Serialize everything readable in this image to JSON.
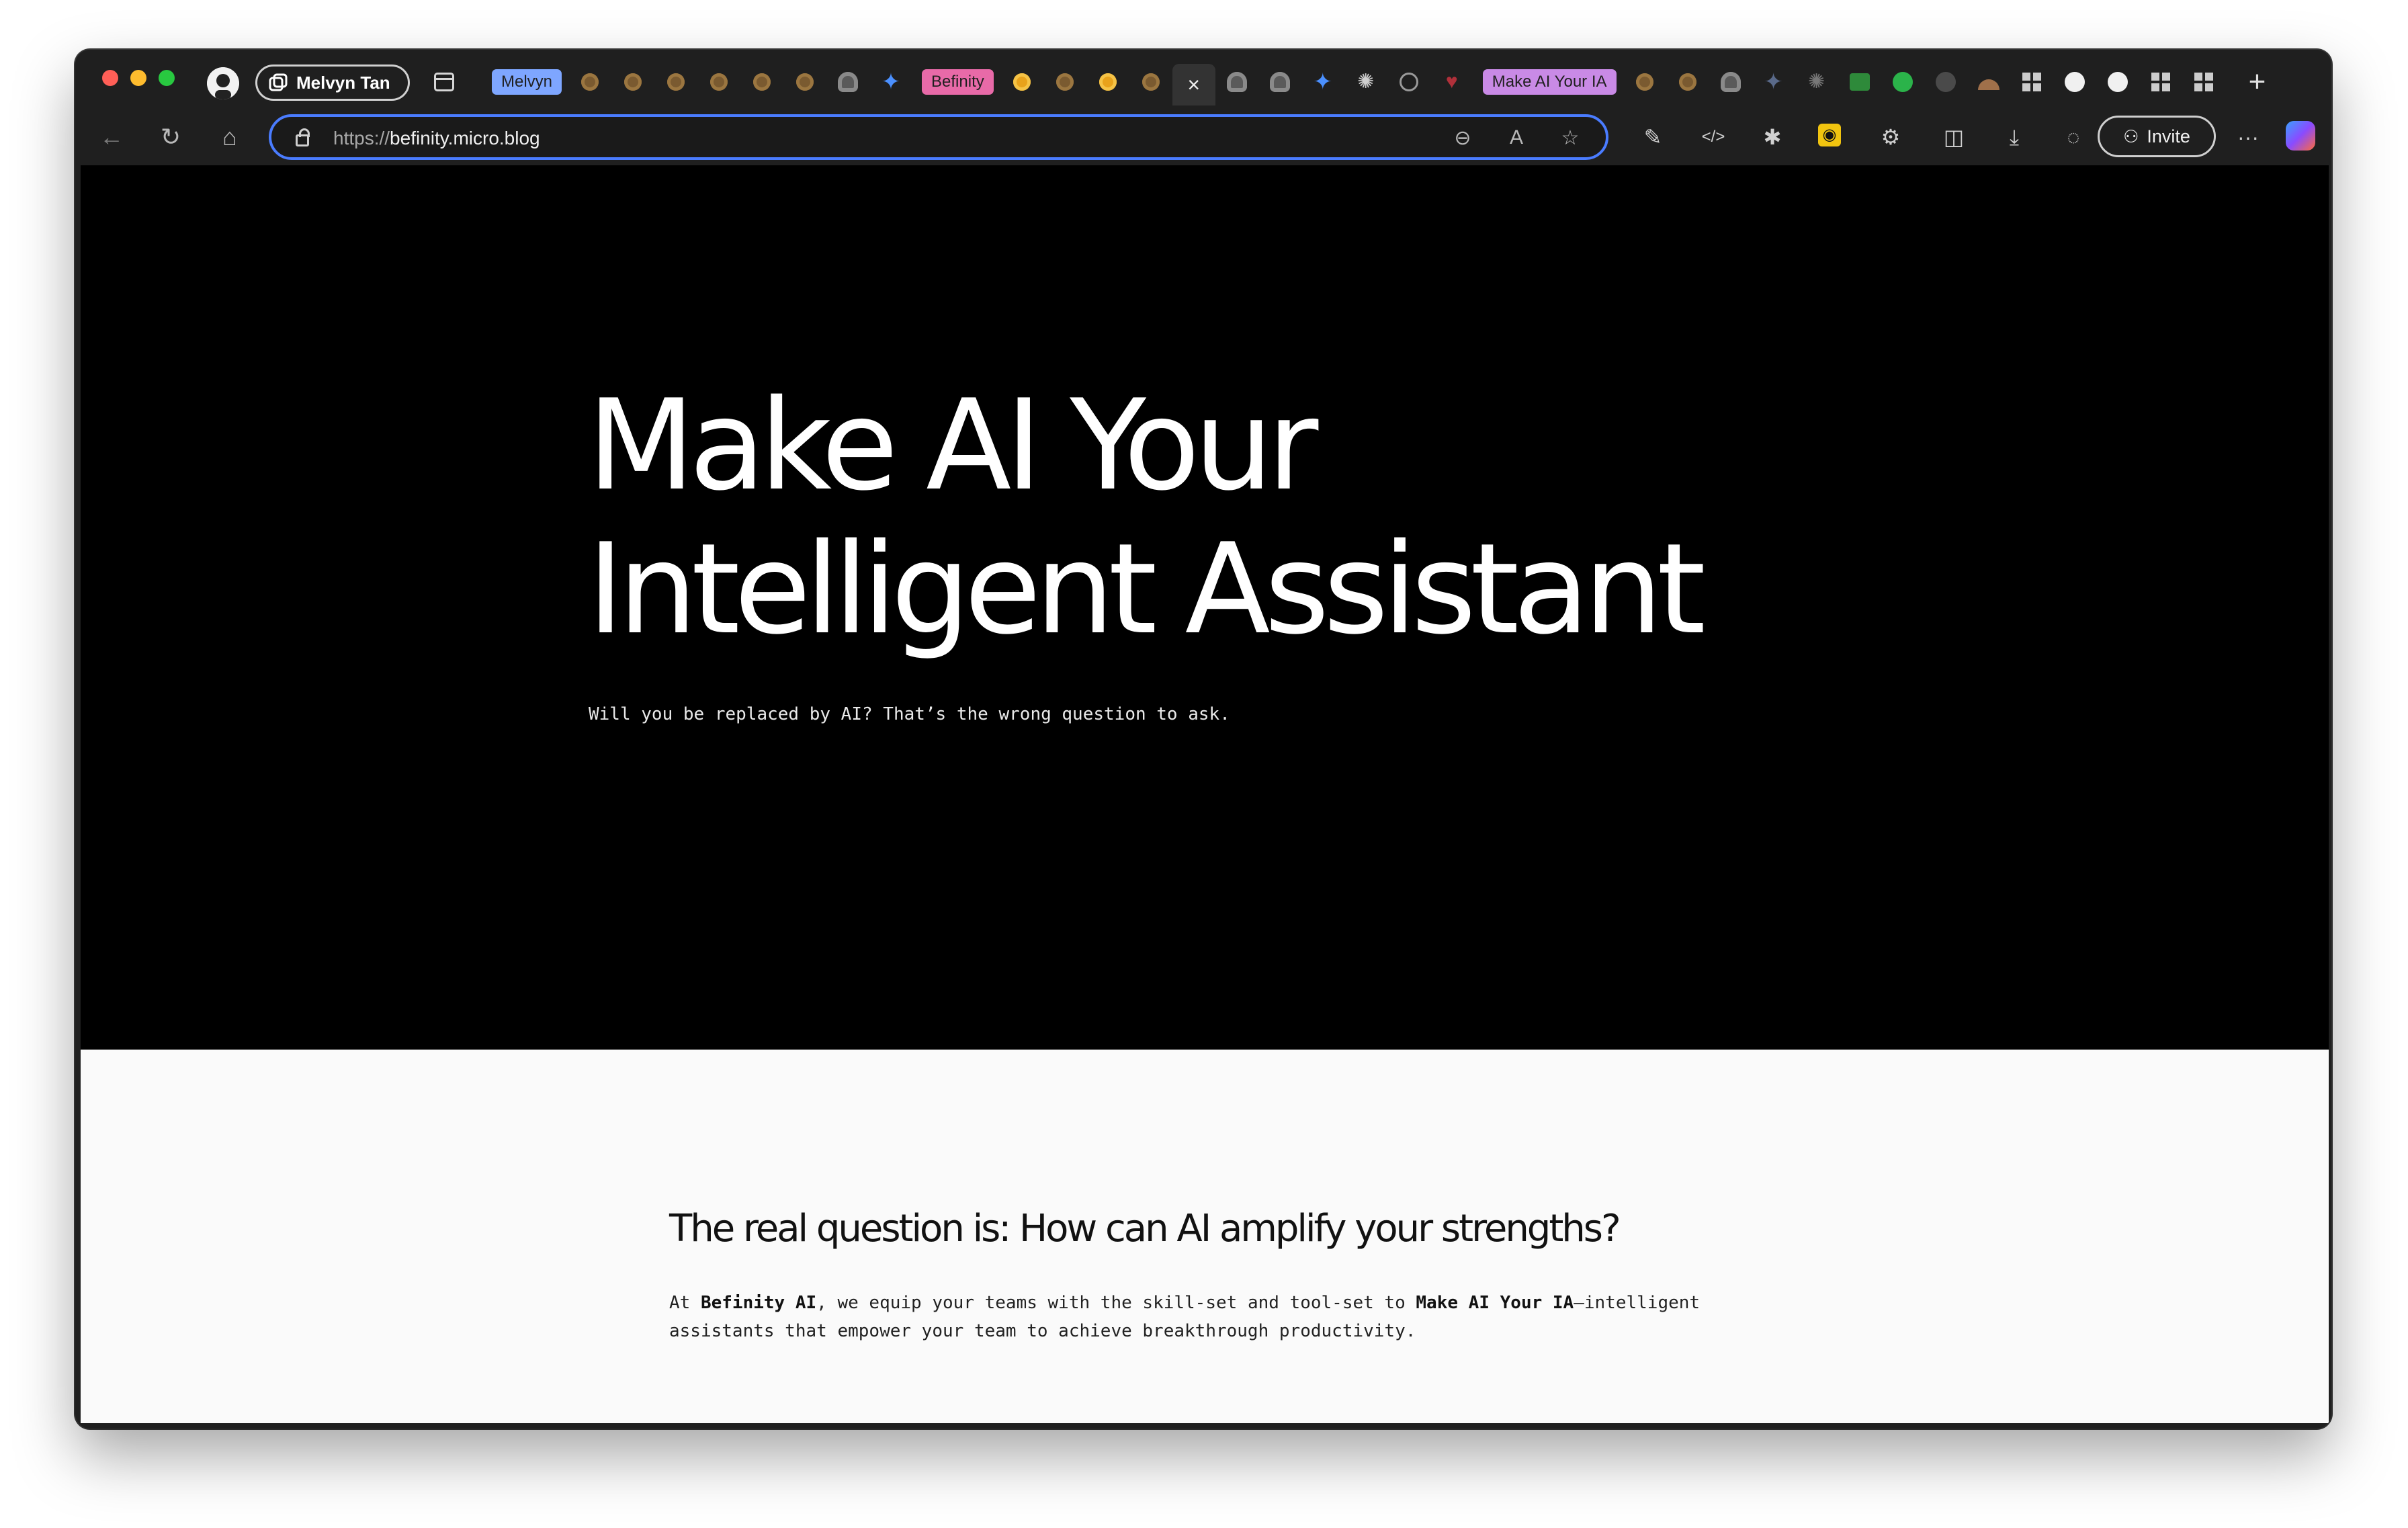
{
  "browser": {
    "profile_name": "Melvyn Tan",
    "tab_groups": [
      {
        "label": "Melvyn",
        "color": "#7ea6ff"
      },
      {
        "label": "Befinity",
        "color": "#e86aa8"
      },
      {
        "label": "Make AI Your IA",
        "color": "#c98ae6"
      }
    ],
    "address": {
      "scheme": "https://",
      "host": "befinity.micro.blog"
    },
    "invite_label": "Invite"
  },
  "hero": {
    "title_line1": "Make AI Your",
    "title_line2": "Intelligent Assistant",
    "subtitle": "Will you be replaced by AI? That’s the wrong question to ask."
  },
  "section": {
    "heading": "The real question is: How can AI amplify your strengths?",
    "body_prefix": "At ",
    "body_brand": "Befinity AI",
    "body_mid": ", we equip your teams with the skill-set and tool-set to ",
    "body_emphasis": "Make AI Your IA",
    "body_suffix": "—intelligent assistants that empower your team to achieve breakthrough productivity."
  },
  "icons": {
    "back": "arrow-left-icon",
    "reload": "reload-icon",
    "home": "home-icon",
    "zoom": "zoom-out-icon",
    "read_aloud": "read-aloud-icon",
    "favorite": "star-icon",
    "extensions": "puzzle-icon",
    "split": "split-screen-icon",
    "downloads": "download-icon",
    "feedback": "chat-icon",
    "more": "ellipsis-icon",
    "copilot": "copilot-icon"
  }
}
